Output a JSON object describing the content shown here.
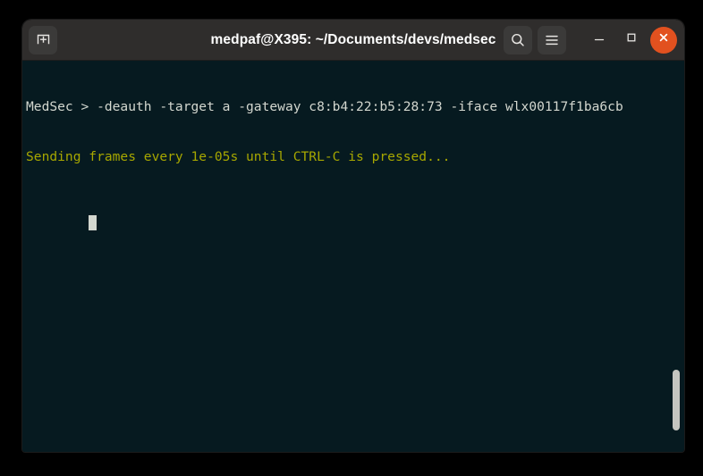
{
  "window": {
    "title": "medpaf@X395: ~/Documents/devs/medsec",
    "colors": {
      "desktop_background": "#000000",
      "titlebar_background": "#2f2d2c",
      "terminal_background": "#061a20",
      "close_button": "#e2511f",
      "text_white": "#d3d7cf",
      "text_yellow": "#a7a700",
      "cursor": "#d3d7cf",
      "scrollbar_thumb": "#c5c5c0"
    }
  },
  "titlebar": {
    "new_tab": {
      "icon": "new-tab-icon",
      "label": "New Tab"
    },
    "search": {
      "icon": "search-icon",
      "label": "Find"
    },
    "menu": {
      "icon": "hamburger-menu-icon",
      "label": "Main Menu"
    },
    "minimize": {
      "icon": "minimize-icon",
      "label": "Minimize"
    },
    "maximize": {
      "icon": "maximize-icon",
      "label": "Maximize"
    },
    "close": {
      "icon": "close-icon",
      "label": "Close"
    }
  },
  "terminal": {
    "lines": [
      {
        "id": "command-line",
        "color": "white",
        "text": "MedSec > -deauth -target a -gateway c8:b4:22:b5:28:73 -iface wlx00117f1ba6cb"
      },
      {
        "id": "status-line",
        "color": "yellow",
        "text": "Sending frames every 1e-05s until CTRL-C is pressed..."
      }
    ],
    "cursor": {
      "type": "block",
      "visible": true
    }
  },
  "scrollbar": {
    "orientation": "vertical",
    "thumb_position_percent": 84
  }
}
